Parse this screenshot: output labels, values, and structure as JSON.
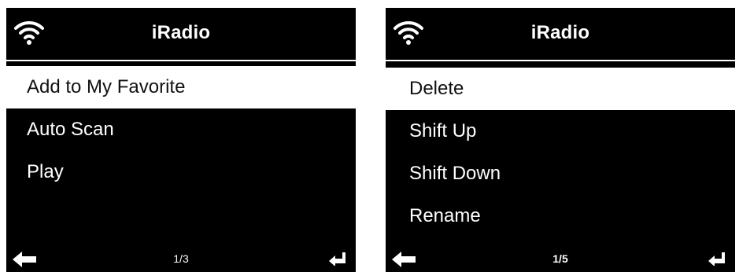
{
  "screens": [
    {
      "title": "iRadio",
      "items": [
        "Add to My Favorite",
        "Auto Scan",
        "Play"
      ],
      "selected_index": 0,
      "page": "1/3"
    },
    {
      "title": "iRadio",
      "items": [
        "Delete",
        "Shift Up",
        "Shift Down",
        "Rename"
      ],
      "selected_index": 0,
      "page": "1/5"
    }
  ],
  "icons": {
    "status": "wifi-icon",
    "back": "back-arrow-icon",
    "enter": "enter-icon"
  },
  "colors": {
    "background": "#000000",
    "text": "#ffffff",
    "highlight": "#ffffff",
    "highlight_text": "#111111"
  }
}
